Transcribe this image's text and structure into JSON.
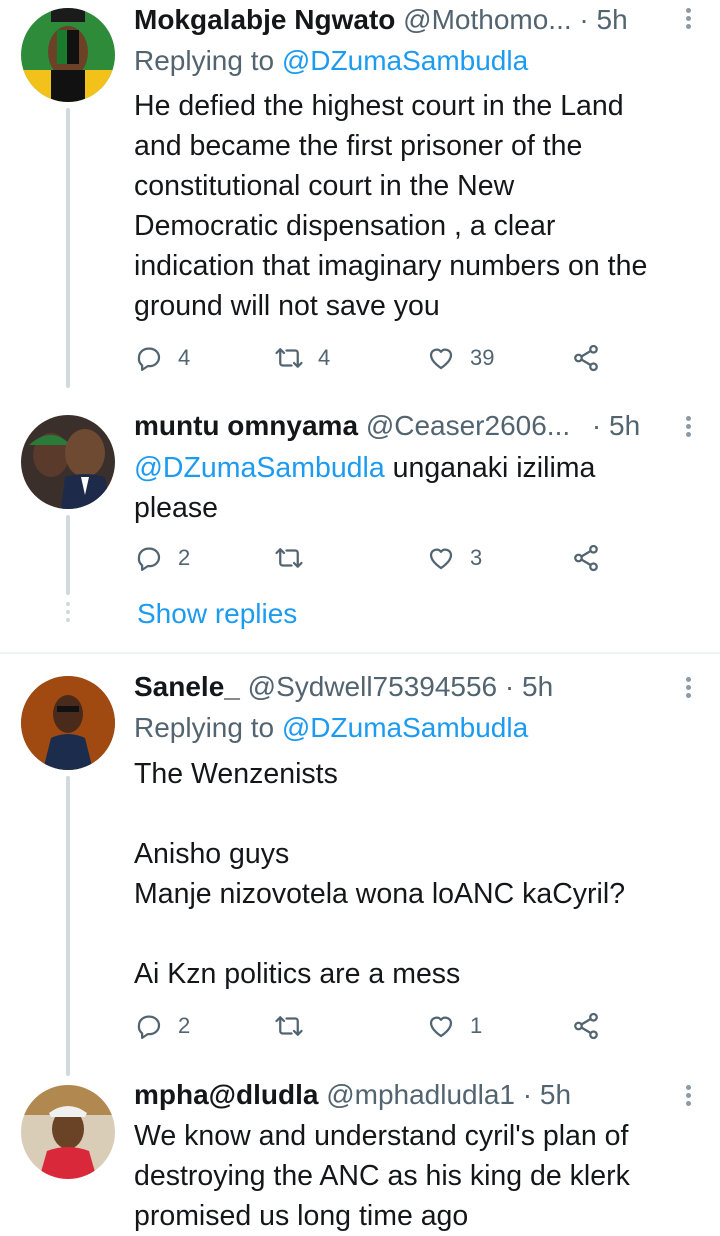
{
  "tweets": [
    {
      "name": "Mokgalabje Ngwato",
      "handle": "@Mothomo...",
      "time": "· 5h",
      "replying_prefix": "Replying to ",
      "replying_to": "@DZumaSambudla",
      "text": "He defied the highest court in the Land\nand became the first prisoner of the\nconstitutional court in the New\nDemocratic dispensation , a clear\nindication that imaginary numbers on the\nground will not save you",
      "replies": "4",
      "retweets": "4",
      "likes": "39"
    },
    {
      "name": "muntu omnyama",
      "handle": "@Ceaser2606...",
      "time": "· 5h",
      "mention": "@DZumaSambudla",
      "text": " unganaki izilima\nplease",
      "replies": "2",
      "retweets": "",
      "likes": "3"
    },
    {
      "name": "Sanele_",
      "handle": "@Sydwell75394556",
      "time": "· 5h",
      "replying_prefix": "Replying to ",
      "replying_to": "@DZumaSambudla",
      "text": "The Wenzenists\n\nAnisho guys\nManje nizovotela wona loANC kaCyril?\n\nAi Kzn politics are a mess",
      "replies": "2",
      "retweets": "",
      "likes": "1"
    },
    {
      "name": "mpha@dludla",
      "handle": "@mphadludla1",
      "time": "· 5h",
      "text": "We know and understand cyril's plan of\ndestroying the ANC as his king de klerk\npromised us long time ago"
    }
  ],
  "show_replies": "Show replies",
  "icons": {
    "reply": "reply-icon",
    "retweet": "retweet-icon",
    "like": "heart-icon",
    "share": "share-icon",
    "more": "more-vertical-icon"
  },
  "colors": {
    "link": "#1d9bf0",
    "secondary_text": "#536471",
    "thread_line": "#cfd9de"
  }
}
